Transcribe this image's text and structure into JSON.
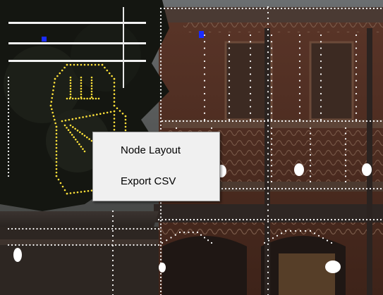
{
  "context_menu": {
    "items": [
      {
        "label": "Node Layout"
      },
      {
        "label": "Export CSV"
      }
    ]
  },
  "colors": {
    "menu_background": "#f0f0f0",
    "light_node_white": "#ffffff",
    "light_node_yellow": "#ffe23a",
    "light_node_selected": "#1a2cff"
  }
}
